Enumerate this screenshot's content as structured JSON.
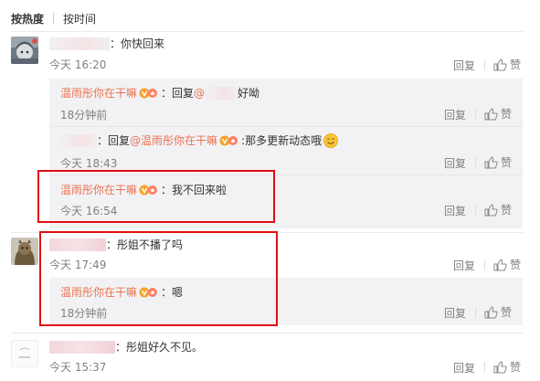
{
  "sort": {
    "hot": "按热度",
    "time": "按时间"
  },
  "actions": {
    "reply": "回复",
    "like": "赞"
  },
  "comments": [
    {
      "text": "：你快回来",
      "time": "今天 16:20",
      "replies": [
        {
          "user": "温雨彤你在干嘛",
          "prefix": "：回复",
          "at": "@",
          "text": "好呦",
          "time": "18分钟前"
        },
        {
          "prefix": "：回复",
          "at": "@温雨彤你在干嘛",
          "text": ":那多更新动态哦",
          "time": "今天 18:43"
        },
        {
          "user": "温雨彤你在干嘛",
          "text": "：我不回来啦",
          "time": "今天 16:54"
        }
      ]
    },
    {
      "text": "：彤姐不播了吗",
      "time": "今天 17:49",
      "replies": [
        {
          "user": "温雨彤你在干嘛",
          "text": "：嗯",
          "time": "18分钟前"
        }
      ]
    },
    {
      "text": "：彤姐好久不见。",
      "time": "今天 15:37"
    }
  ]
}
